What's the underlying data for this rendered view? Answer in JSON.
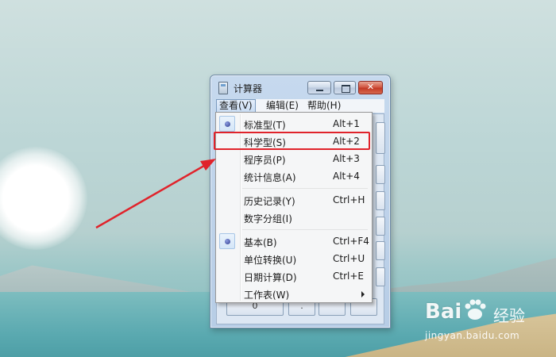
{
  "window": {
    "title": "计算器",
    "close_glyph": "✕"
  },
  "menubar": {
    "view": "查看(V)",
    "edit": "编辑(E)",
    "help": "帮助(H)"
  },
  "view_menu": {
    "items": [
      {
        "label": "标准型(T)",
        "shortcut": "Alt+1",
        "checked": true
      },
      {
        "label": "科学型(S)",
        "shortcut": "Alt+2",
        "checked": false,
        "highlighted": true
      },
      {
        "label": "程序员(P)",
        "shortcut": "Alt+3",
        "checked": false
      },
      {
        "label": "统计信息(A)",
        "shortcut": "Alt+4",
        "checked": false
      },
      {
        "label": "历史记录(Y)",
        "shortcut": "Ctrl+H",
        "checked": false
      },
      {
        "label": "数字分组(I)",
        "shortcut": "",
        "checked": false
      },
      {
        "label": "基本(B)",
        "shortcut": "Ctrl+F4",
        "checked": true
      },
      {
        "label": "单位转换(U)",
        "shortcut": "Ctrl+U",
        "checked": false
      },
      {
        "label": "日期计算(D)",
        "shortcut": "Ctrl+E",
        "checked": false
      },
      {
        "label": "工作表(W)",
        "shortcut": "",
        "checked": false,
        "submenu": true
      }
    ]
  },
  "calc_buttons": {
    "zero": "0",
    "dot": "."
  },
  "watermark": {
    "logo": "Bai",
    "text": "经验",
    "url": "jingyan.baidu.com"
  },
  "colors": {
    "highlight": "#e0232b",
    "arrow": "#e0232b"
  }
}
